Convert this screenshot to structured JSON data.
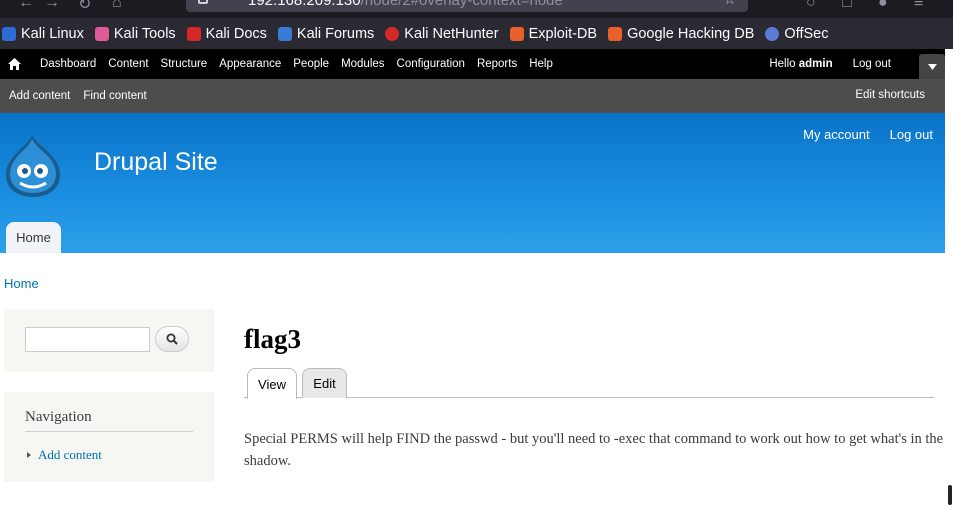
{
  "browser": {
    "url_host": "192.168.209.130",
    "url_path": "/node/2#overlay-context=node",
    "bookmarks": [
      {
        "label": "Kali Linux",
        "icon": "kali-dragon-icon",
        "color": "#2c6cd6"
      },
      {
        "label": "Kali Tools",
        "icon": "kali-tools-icon",
        "color": "#e05a9a"
      },
      {
        "label": "Kali Docs",
        "icon": "kali-docs-icon",
        "color": "#d62828"
      },
      {
        "label": "Kali Forums",
        "icon": "kali-forums-icon",
        "color": "#3a7bd5"
      },
      {
        "label": "Kali NetHunter",
        "icon": "nethunter-icon",
        "color": "#d62828"
      },
      {
        "label": "Exploit-DB",
        "icon": "exploit-db-icon",
        "color": "#e8602c"
      },
      {
        "label": "Google Hacking DB",
        "icon": "ghdb-icon",
        "color": "#e8602c"
      },
      {
        "label": "OffSec",
        "icon": "offsec-icon",
        "color": "#5a7bd5"
      }
    ]
  },
  "toolbar": {
    "menu": [
      "Dashboard",
      "Content",
      "Structure",
      "Appearance",
      "People",
      "Modules",
      "Configuration",
      "Reports",
      "Help"
    ],
    "hello_prefix": "Hello ",
    "user": "admin",
    "logout": "Log out"
  },
  "shortcuts": {
    "items": [
      "Add content",
      "Find content"
    ],
    "edit": "Edit shortcuts"
  },
  "header": {
    "site_name": "Drupal Site",
    "secondary": [
      "My account",
      "Log out"
    ],
    "main_tab": "Home",
    "brand_color": "#0a73c9"
  },
  "breadcrumb": "Home",
  "sidebar": {
    "search_value": "",
    "nav_title": "Navigation",
    "nav_items": [
      "Add content"
    ]
  },
  "content": {
    "title": "flag3",
    "tabs": [
      "View",
      "Edit"
    ],
    "active_tab": "View",
    "body": "Special PERMS will help FIND the passwd - but you'll need to -exec that command to work out how to get what's in the shadow."
  }
}
